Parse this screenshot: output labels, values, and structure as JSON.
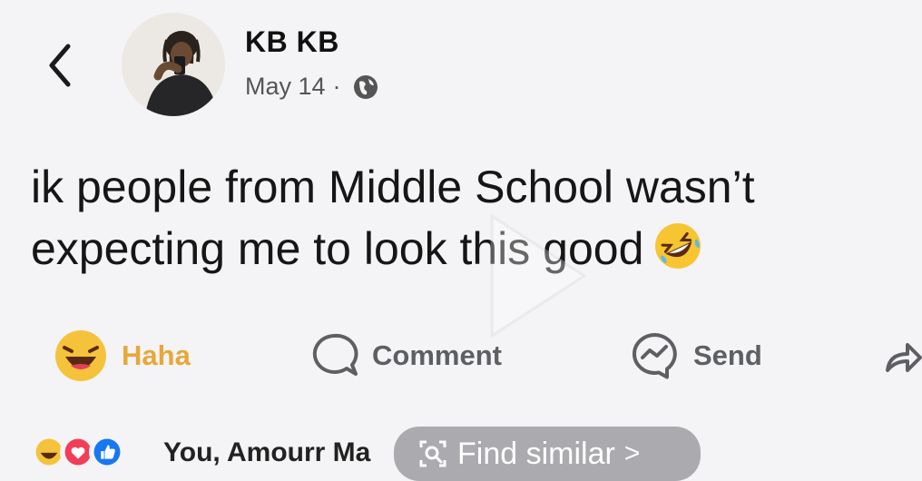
{
  "header": {
    "author_name": "KB KB",
    "date": "May 14",
    "separator": "·"
  },
  "post": {
    "line1": "ik people from Middle School wasn’t",
    "line2": "expecting me to look this good"
  },
  "actions": {
    "haha_label": "Haha",
    "comment_label": "Comment",
    "send_label": "Send"
  },
  "reactions": {
    "names_text": "You, Amourr Ma"
  },
  "overlay": {
    "label": "Find similar",
    "chevron": ">"
  },
  "colors": {
    "haha_accent": "#e6a83a",
    "like_blue": "#1877f2",
    "love_pink": "#f33e58",
    "background": "#f4f4f6"
  },
  "icons": [
    "back-arrow-icon",
    "globe-icon",
    "rofl-emoji-icon",
    "play-icon",
    "haha-emoji-icon",
    "comment-icon",
    "messenger-icon",
    "share-icon",
    "like-reaction-icon",
    "love-reaction-icon",
    "search-icon"
  ]
}
